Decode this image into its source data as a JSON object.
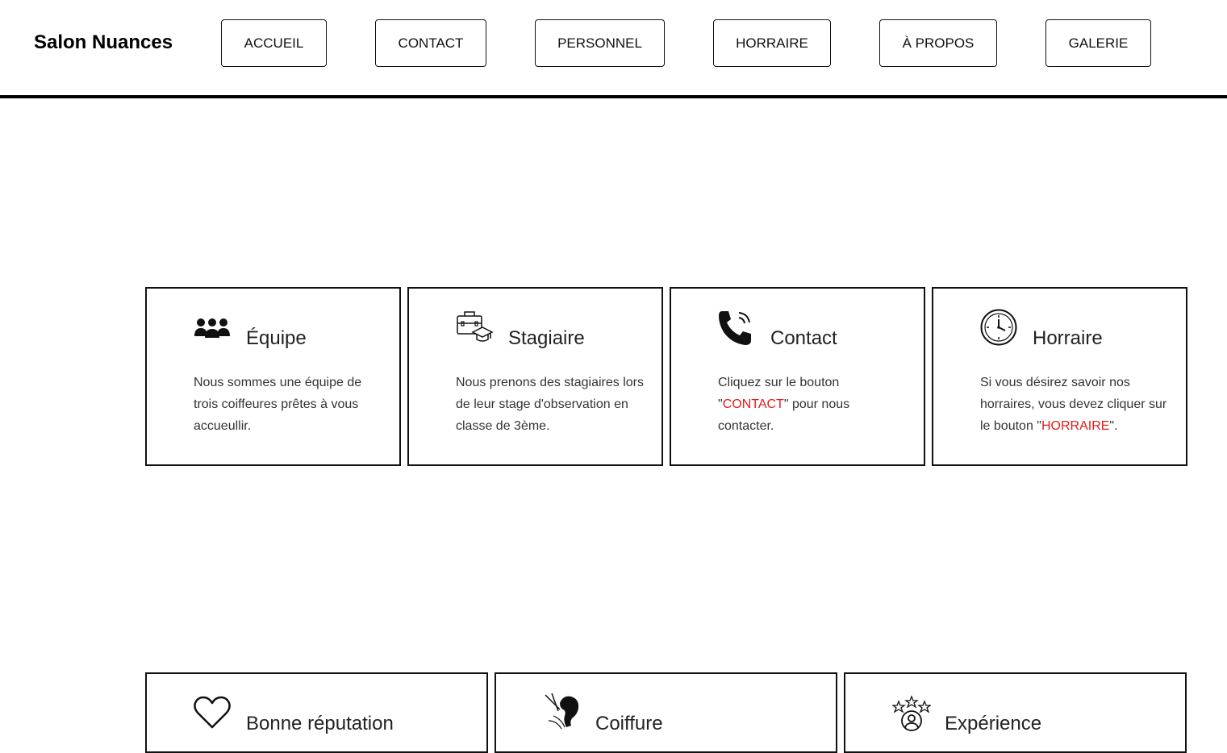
{
  "header": {
    "brand": "Salon Nuances",
    "nav": [
      {
        "label": "ACCUEIL"
      },
      {
        "label": "CONTACT"
      },
      {
        "label": "PERSONNEL"
      },
      {
        "label": "HORRAIRE"
      },
      {
        "label": "À PROPOS"
      },
      {
        "label": "GALERIE"
      }
    ]
  },
  "cards": [
    {
      "icon": "team-icon",
      "title": "Équipe",
      "text": "Nous sommes une équipe de trois coiffeures prêtes à vous accueullir."
    },
    {
      "icon": "briefcase-graduation-icon",
      "title": "Stagiaire",
      "text": "Nous prenons des stagiaires lors de leur stage d'observation en classe de 3ème."
    },
    {
      "icon": "phone-icon",
      "title": "Contact",
      "text_before": "Cliquez sur le bouton \"",
      "link": "CONTACT",
      "text_after": "\" pour nous contacter."
    },
    {
      "icon": "clock-icon",
      "title": "Horraire",
      "text_before": "Si vous désirez savoir nos horraires, vous devez cliquer sur le bouton \"",
      "link": "HORRAIRE",
      "text_after": "\"."
    }
  ],
  "cards_bottom": [
    {
      "icon": "heart-icon",
      "title": "Bonne réputation"
    },
    {
      "icon": "hair-icon",
      "title": "Coiffure"
    },
    {
      "icon": "stars-user-icon",
      "title": "Expérience"
    }
  ],
  "colors": {
    "accent_link": "#e31b1b",
    "border": "#111111",
    "background": "#ffffff"
  }
}
